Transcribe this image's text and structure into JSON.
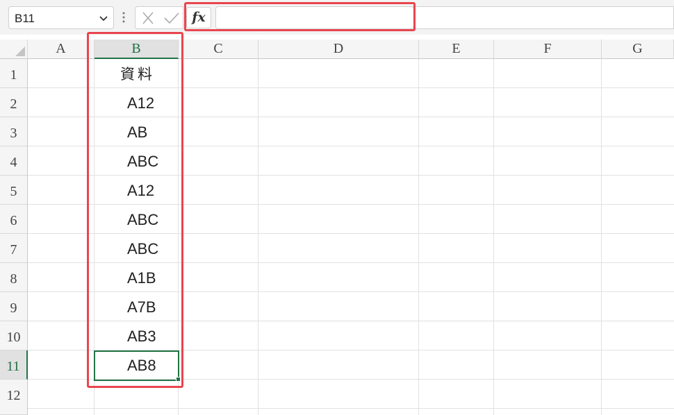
{
  "name_box": {
    "value": "B11"
  },
  "formula": {
    "fx_label": "fx",
    "value": ""
  },
  "columns": [
    "A",
    "B",
    "C",
    "D",
    "E",
    "F",
    "G"
  ],
  "rows": [
    "1",
    "2",
    "3",
    "4",
    "5",
    "6",
    "7",
    "8",
    "9",
    "10",
    "11",
    "12"
  ],
  "cells_B": [
    "資料",
    "A12",
    "AB",
    "ABC",
    "A12",
    "ABC",
    "ABC",
    "A1B",
    "A7B",
    "AB3",
    "AB8"
  ],
  "selected": {
    "column": "B",
    "row": "11"
  },
  "colors": {
    "highlight": "#e9454f",
    "selection": "#217346"
  }
}
